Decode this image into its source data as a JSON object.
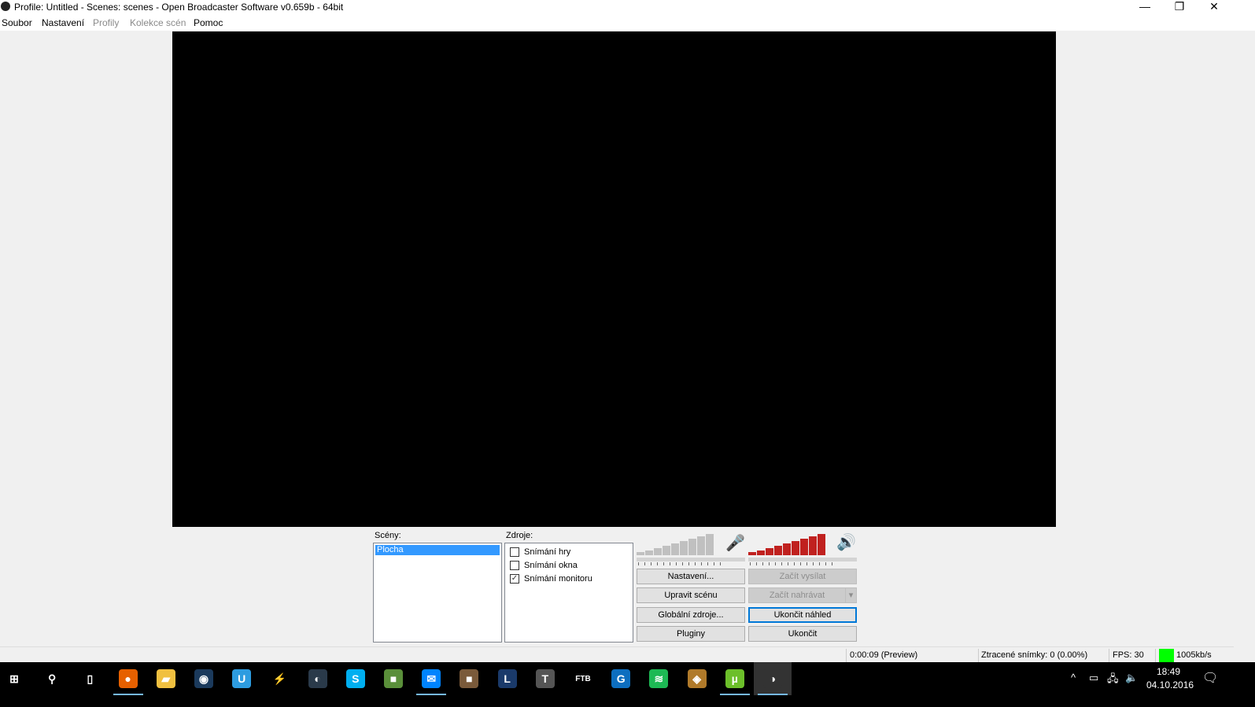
{
  "window": {
    "title": "Profile: Untitled - Scenes: scenes - Open Broadcaster Software v0.659b - 64bit",
    "minimize": "—",
    "restore": "❐",
    "close": "✕"
  },
  "menu": [
    "Soubor",
    "Nastavení",
    "Profily",
    "Kolekce scén",
    "Pomoc"
  ],
  "scenes": {
    "label": "Scény:",
    "items": [
      "Plocha"
    ]
  },
  "sources": {
    "label": "Zdroje:",
    "items": [
      {
        "label": "Snímání hry",
        "checked": false
      },
      {
        "label": "Snímání okna",
        "checked": false
      },
      {
        "label": "Snímání monitoru",
        "checked": true,
        "mark": "✓"
      }
    ]
  },
  "audio": {
    "mic_level": 0,
    "desktop_level": 1.0,
    "mic_color": "#c0c0c0",
    "desktop_color": "#c0211f"
  },
  "buttons": {
    "settings": "Nastavení...",
    "start_stream": "Začít vysílat",
    "edit_scene": "Upravit scénu",
    "start_record": "Začít nahrávat",
    "global_sources": "Globální zdroje...",
    "stop_preview": "Ukončit náhled",
    "plugins": "Pluginy",
    "exit": "Ukončit",
    "dropdown": "▾"
  },
  "status": {
    "time": "0:00:09 (Preview)",
    "dropped": "Ztracené snímky: 0 (0.00%)",
    "fps": "FPS: 30",
    "bitrate": "1005kb/s",
    "indicator_color": "#00ff00"
  },
  "taskbar": {
    "apps": [
      {
        "name": "start",
        "glyph": "⊞",
        "color": "#000"
      },
      {
        "name": "search",
        "glyph": "⚲",
        "color": "#000"
      },
      {
        "name": "task-view",
        "glyph": "▯",
        "color": "#000"
      },
      {
        "name": "firefox",
        "glyph": "●",
        "color": "#e66000",
        "active": true
      },
      {
        "name": "file-explorer",
        "glyph": "▰",
        "color": "#f0c040"
      },
      {
        "name": "steam",
        "glyph": "◉",
        "color": "#1b3a5c"
      },
      {
        "name": "uplay",
        "glyph": "U",
        "color": "#2d9ce0"
      },
      {
        "name": "winamp",
        "glyph": "⚡",
        "color": "#000"
      },
      {
        "name": "teamspeak",
        "glyph": "◐",
        "color": "#2a3a4a"
      },
      {
        "name": "skype",
        "glyph": "S",
        "color": "#00aff0"
      },
      {
        "name": "minecraft",
        "glyph": "■",
        "color": "#5a8f3a"
      },
      {
        "name": "messenger",
        "glyph": "✉",
        "color": "#0084ff",
        "active": true
      },
      {
        "name": "minecraft-launcher",
        "glyph": "■",
        "color": "#7a5a3a"
      },
      {
        "name": "league-of-legends",
        "glyph": "L",
        "color": "#1a3a6a"
      },
      {
        "name": "world-of-tanks",
        "glyph": "T",
        "color": "#555"
      },
      {
        "name": "ftb",
        "glyph": "FTB",
        "color": "#000"
      },
      {
        "name": "app-g",
        "glyph": "G",
        "color": "#0d6ebf"
      },
      {
        "name": "spotify",
        "glyph": "≋",
        "color": "#1db954"
      },
      {
        "name": "hearthstone",
        "glyph": "◈",
        "color": "#b07a2a"
      },
      {
        "name": "utorrent",
        "glyph": "µ",
        "color": "#6cbf2a",
        "active": true
      },
      {
        "name": "obs",
        "glyph": "◑",
        "color": "#333",
        "active": true
      }
    ],
    "tray": {
      "chevron": "^",
      "power": "▭",
      "network": "🖧",
      "volume": "🔈",
      "time": "18:49",
      "date": "04.10.2016",
      "notifications": "🗨"
    }
  }
}
